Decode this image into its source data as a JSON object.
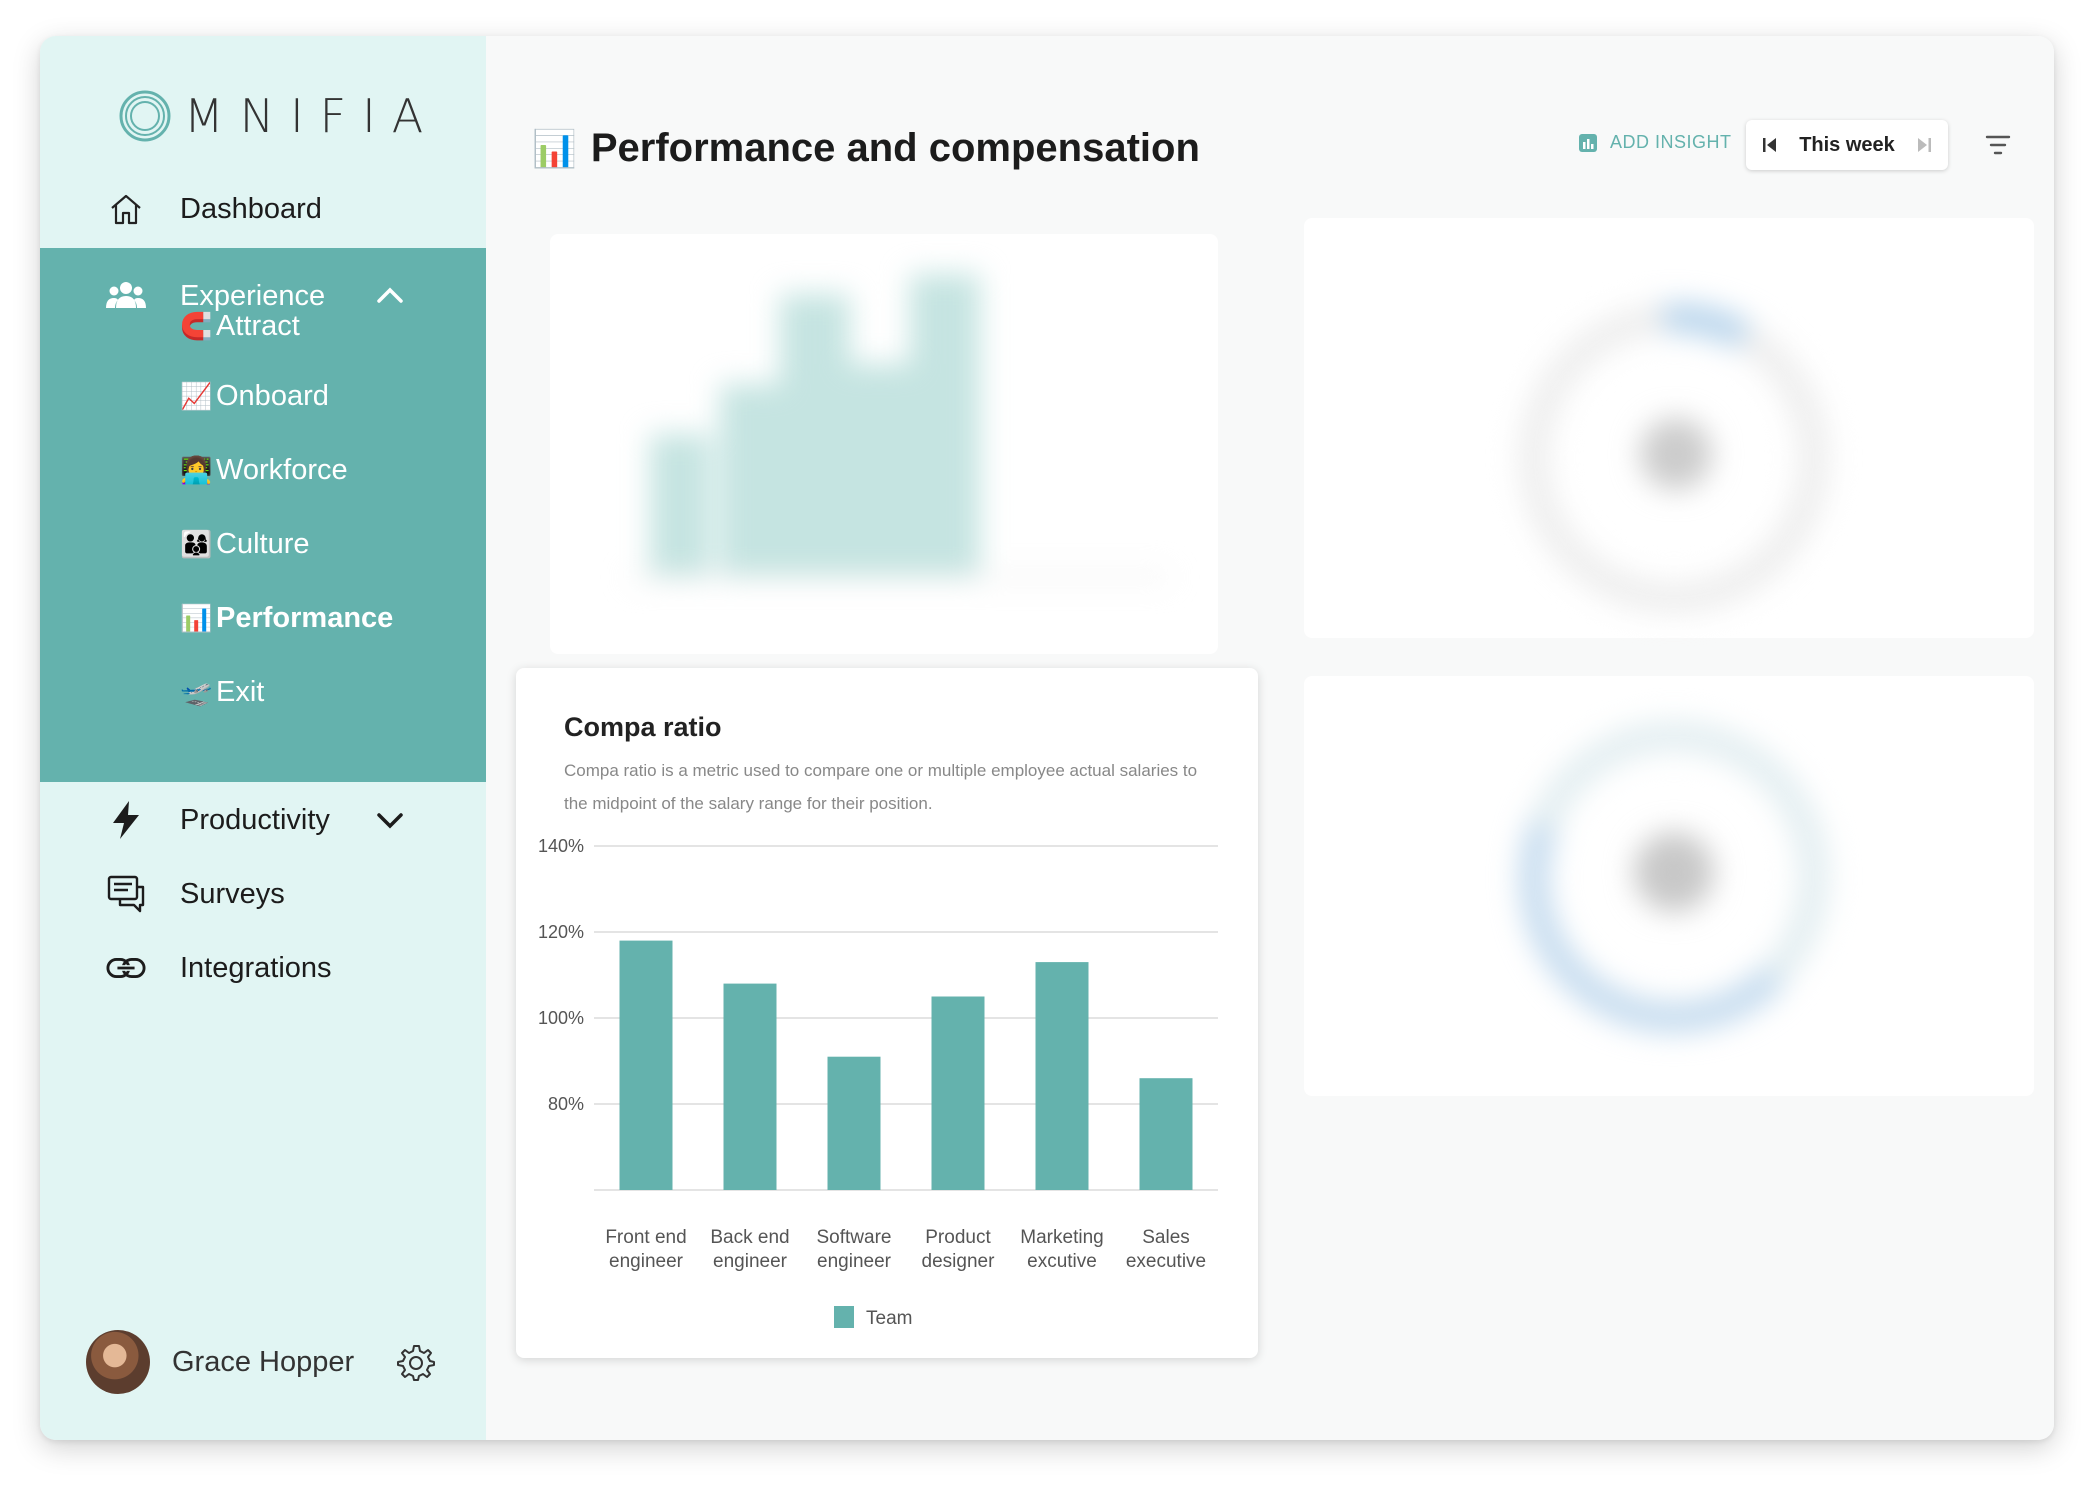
{
  "sidebar": {
    "logo_text": "MNIFIA",
    "items": [
      {
        "label": "Dashboard",
        "icon": "home-icon"
      },
      {
        "label": "Experience",
        "icon": "people-icon",
        "expanded": true
      },
      {
        "label": "Productivity",
        "icon": "lightning-icon"
      },
      {
        "label": "Surveys",
        "icon": "chat-icon"
      },
      {
        "label": "Integrations",
        "icon": "link-icon"
      }
    ],
    "subitems": [
      {
        "emoji": "🧲",
        "label": "Attract"
      },
      {
        "emoji": "📈",
        "label": "Onboard"
      },
      {
        "emoji": "👩‍💻",
        "label": "Workforce"
      },
      {
        "emoji": "👨‍👩‍👦",
        "label": "Culture"
      },
      {
        "emoji": "📊",
        "label": "Performance",
        "active": true
      },
      {
        "emoji": "🛫",
        "label": "Exit"
      }
    ],
    "user": {
      "name": "Grace Hopper"
    },
    "accent": "#64b2ad",
    "background": "#e1f5f3"
  },
  "header": {
    "emoji": "📊",
    "title": "Performance and compensation",
    "add_insight": "ADD INSIGHT",
    "week_label": "This week"
  },
  "card": {
    "title": "Compa ratio",
    "description": "Compa ratio is a metric used to compare one or multiple employee actual salaries to the midpoint of the salary range for their position."
  },
  "chart_data": {
    "type": "bar",
    "categories": [
      [
        "Front end",
        "engineer"
      ],
      [
        "Back end",
        "engineer"
      ],
      [
        "Software",
        "engineer"
      ],
      [
        "Product",
        "designer"
      ],
      [
        "Marketing",
        "excutive"
      ],
      [
        "Sales",
        "executive"
      ]
    ],
    "series": [
      {
        "name": "Team",
        "values": [
          118,
          108,
          91,
          105,
          113,
          86
        ],
        "color": "#64b2ad"
      }
    ],
    "y_ticks": [
      "140%",
      "120%",
      "100%",
      "80%"
    ],
    "y_tick_values": [
      140,
      120,
      100,
      80
    ],
    "ylim": [
      60,
      140
    ],
    "grid": true,
    "legend": "bottom-center"
  }
}
